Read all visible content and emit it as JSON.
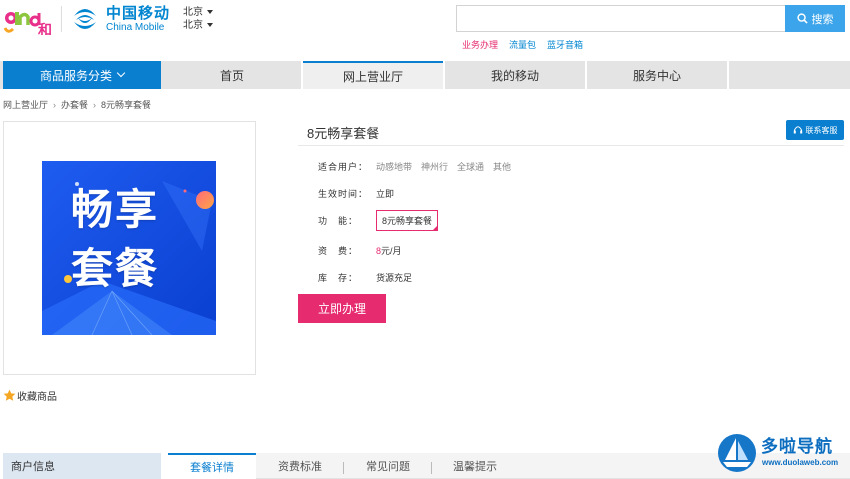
{
  "header": {
    "logo_brand_cn": "中国移动",
    "logo_brand_en": "China Mobile",
    "city_1": "北京",
    "city_2": "北京",
    "search_value": "",
    "search_button": "搜索",
    "hotlinks": [
      "业务办理",
      "流量包",
      "蓝牙音箱"
    ]
  },
  "nav": {
    "category": "商品服务分类",
    "items": [
      "首页",
      "网上营业厅",
      "我的移动",
      "服务中心"
    ]
  },
  "breadcrumb": [
    "网上营业厅",
    "办套餐",
    "8元畅享套餐"
  ],
  "banner": {
    "line1": "畅享",
    "line2": "套餐"
  },
  "favorite": "收藏商品",
  "product": {
    "title": "8元畅享套餐",
    "service_button": "联系客服",
    "users_label": "适合用户：",
    "users_options": [
      "动感地带",
      "神州行",
      "全球通",
      "其他"
    ],
    "effect_label": "生效时间：",
    "effect_value": "立即",
    "function_label": "功　能：",
    "function_value": "8元畅享套餐",
    "price_label": "资　费：",
    "price_num": "8",
    "price_unit": "元/月",
    "stock_label": "库　存：",
    "stock_value": "货源充足",
    "buy_button": "立即办理"
  },
  "bottom": {
    "biz_info": "商户信息",
    "tabs": [
      "套餐详情",
      "资费标准",
      "常见问题",
      "温馨提示"
    ]
  },
  "watermark": {
    "name": "多啦导航",
    "url": "www.duolaweb.com"
  },
  "colors": {
    "brand_blue": "#0a7fd0",
    "accent_pink": "#e62b6e",
    "search_blue": "#3ba4ea"
  }
}
